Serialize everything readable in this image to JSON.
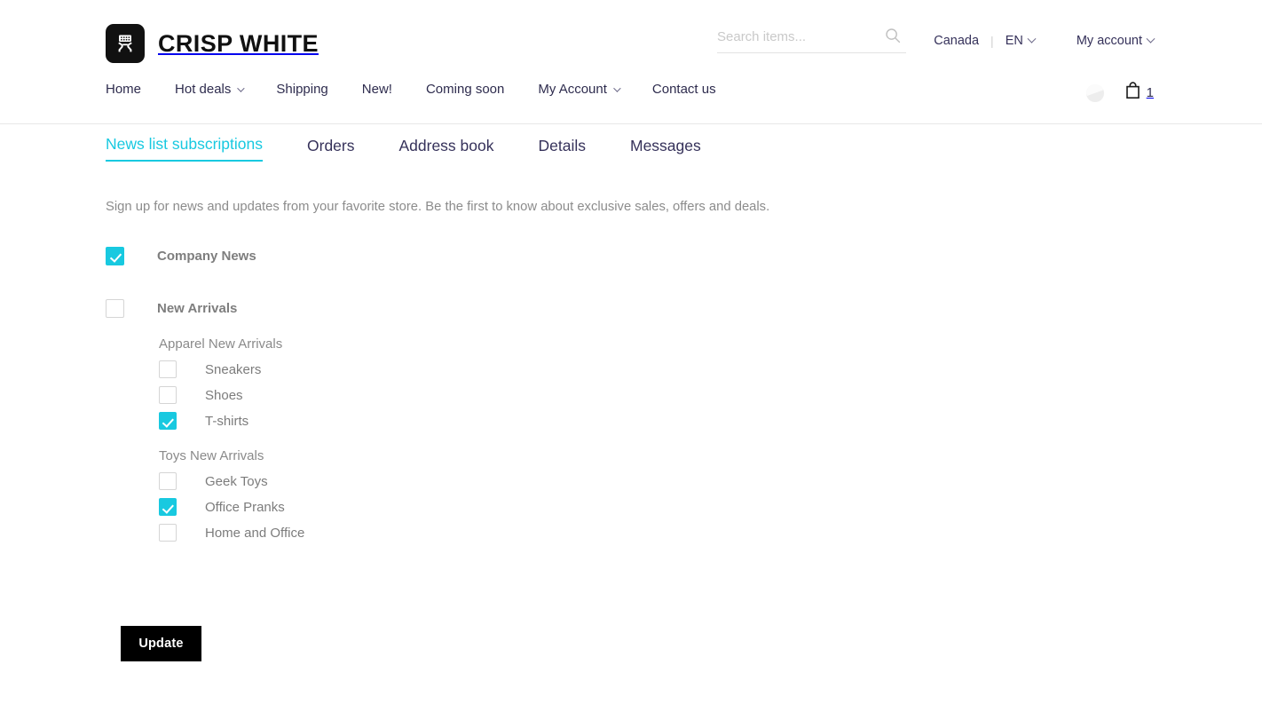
{
  "header": {
    "brand_name": "CRISP WHITE",
    "logo_icon": "grill-logo-icon",
    "search": {
      "placeholder": "Search items...",
      "value": "",
      "icon": "search-icon"
    },
    "top_links": {
      "country": "Canada",
      "separator": "|",
      "language": "EN",
      "account": "My account"
    },
    "nav_items": [
      {
        "label": "Home",
        "has_caret": false
      },
      {
        "label": "Hot deals",
        "has_caret": true
      },
      {
        "label": "Shipping",
        "has_caret": false
      },
      {
        "label": "New!",
        "has_caret": false
      },
      {
        "label": "Coming soon",
        "has_caret": false
      },
      {
        "label": "My Account",
        "has_caret": true
      },
      {
        "label": "Contact us",
        "has_caret": false
      }
    ],
    "nav_right": {
      "compare_icon": "compare-circle-icon",
      "cart_icon": "shopping-bag-icon",
      "cart_count": "1"
    }
  },
  "account_tabs": [
    {
      "label": "News list subscriptions",
      "active": true
    },
    {
      "label": "Orders",
      "active": false
    },
    {
      "label": "Address book",
      "active": false
    },
    {
      "label": "Details",
      "active": false
    },
    {
      "label": "Messages",
      "active": false
    }
  ],
  "content": {
    "intro": "Sign up for news and updates from your favorite store. Be the first to know about exclusive sales, offers and deals.",
    "subscriptions": [
      {
        "label": "Company News",
        "checked": true,
        "groups": []
      },
      {
        "label": "New Arrivals",
        "checked": false,
        "groups": [
          {
            "title": "Apparel New Arrivals",
            "items": [
              {
                "label": "Sneakers",
                "checked": false
              },
              {
                "label": "Shoes",
                "checked": false
              },
              {
                "label": "T-shirts",
                "checked": true
              }
            ]
          },
          {
            "title": "Toys New Arrivals",
            "items": [
              {
                "label": "Geek Toys",
                "checked": false
              },
              {
                "label": "Office Pranks",
                "checked": true
              },
              {
                "label": "Home and Office",
                "checked": false
              }
            ]
          }
        ]
      }
    ],
    "update_button": "Update"
  },
  "colors": {
    "accent": "#18c9e0",
    "nav_text": "#2e2c4e",
    "body_text": "#7c7c7c",
    "button_bg": "#000000"
  }
}
